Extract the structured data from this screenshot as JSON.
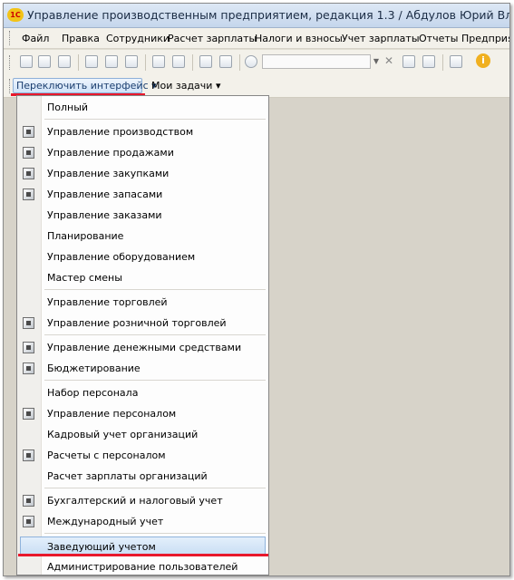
{
  "window": {
    "logo_text": "1С",
    "title": "Управление производственным предприятием, редакция 1.3 / Абдулов Юрий Владимирович /"
  },
  "menubar": {
    "items": [
      {
        "label": "Файл"
      },
      {
        "label": "Правка"
      },
      {
        "label": "Сотрудники"
      },
      {
        "label": "Расчет зарплаты"
      },
      {
        "label": "Налоги и взносы"
      },
      {
        "label": "Учет зарплаты"
      },
      {
        "label": "Отчеты"
      },
      {
        "label": "Предприятие"
      }
    ]
  },
  "toolbar": {
    "info_glyph": "i",
    "clear_glyph": "✕",
    "combo_glyph": "▼"
  },
  "panel": {
    "switch_label": "Переключить интерфейс ▾",
    "tasks_label": "Мои задачи ▾"
  },
  "dropdown": {
    "items": [
      {
        "label": "Полный"
      },
      {
        "label": "Управление производством"
      },
      {
        "label": "Управление продажами"
      },
      {
        "label": "Управление закупками"
      },
      {
        "label": "Управление запасами"
      },
      {
        "label": "Управление заказами"
      },
      {
        "label": "Планирование"
      },
      {
        "label": "Управление оборудованием"
      },
      {
        "label": "Мастер смены"
      },
      {
        "label": "Управление торговлей"
      },
      {
        "label": "Управление розничной торговлей"
      },
      {
        "label": "Управление денежными средствами"
      },
      {
        "label": "Бюджетирование"
      },
      {
        "label": "Набор персонала"
      },
      {
        "label": "Управление персоналом"
      },
      {
        "label": "Кадровый учет организаций"
      },
      {
        "label": "Расчеты с персоналом"
      },
      {
        "label": "Расчет зарплаты организаций"
      },
      {
        "label": "Бухгалтерский и налоговый учет"
      },
      {
        "label": "Международный учет"
      },
      {
        "label": "Заведующий учетом"
      },
      {
        "label": "Администрирование пользователей"
      }
    ],
    "highlighted": "Заведующий учетом"
  },
  "colors": {
    "accent_underline": "#e8182c",
    "highlight_bg": "#c8ddf4"
  }
}
